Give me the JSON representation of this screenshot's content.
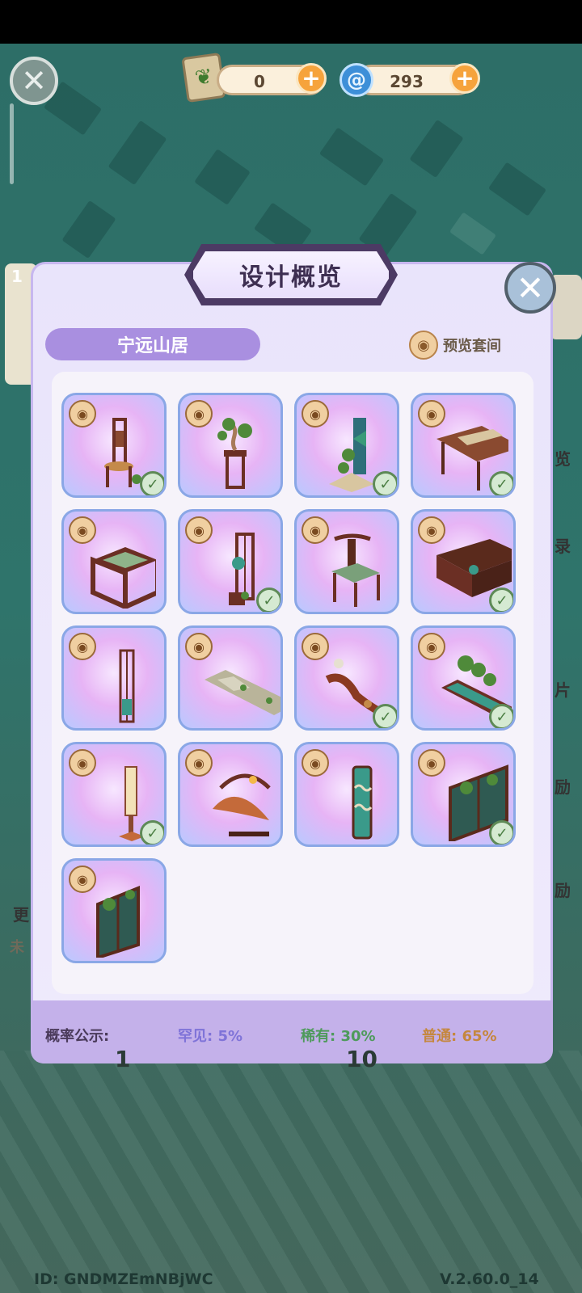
{
  "currency": {
    "leaf_value": "0",
    "swirl_value": "293",
    "plus_symbol": "+"
  },
  "modal": {
    "title": "设计概览",
    "set_name": "宁远山居",
    "preview_label": "预览套间"
  },
  "items": [
    {
      "name": "tall-back-chair",
      "owned": true
    },
    {
      "name": "bonsai-stand",
      "owned": false
    },
    {
      "name": "landscape-screen",
      "owned": true
    },
    {
      "name": "long-table",
      "owned": true
    },
    {
      "name": "square-side-table",
      "owned": false
    },
    {
      "name": "lattice-partition",
      "owned": true
    },
    {
      "name": "armchair",
      "owned": false
    },
    {
      "name": "low-cabinet",
      "owned": true
    },
    {
      "name": "narrow-screen",
      "owned": false
    },
    {
      "name": "stone-path-rug",
      "owned": false
    },
    {
      "name": "root-carving",
      "owned": true
    },
    {
      "name": "planter-trough",
      "owned": true
    },
    {
      "name": "floor-lamp",
      "owned": true
    },
    {
      "name": "leaf-sculpture",
      "owned": false
    },
    {
      "name": "wave-panel",
      "owned": false
    },
    {
      "name": "window-wall",
      "owned": true
    },
    {
      "name": "corner-window",
      "owned": false
    }
  ],
  "probability": {
    "label": "概率公示:",
    "rare": "罕见: 5%",
    "uncommon": "稀有: 30%",
    "common": "普通: 65%",
    "rare_color": "#7f73d8",
    "uncommon_color": "#4e9a5b",
    "common_color": "#c5873e"
  },
  "background": {
    "side_labels": [
      "览",
      "录",
      "片",
      "励",
      "励",
      "更",
      "未"
    ],
    "count_1": "1",
    "count_10": "10",
    "top_left_badge": "1"
  },
  "footer": {
    "id": "ID: GNDMZEmNBjWC",
    "version": "V.2.60.0_14"
  }
}
